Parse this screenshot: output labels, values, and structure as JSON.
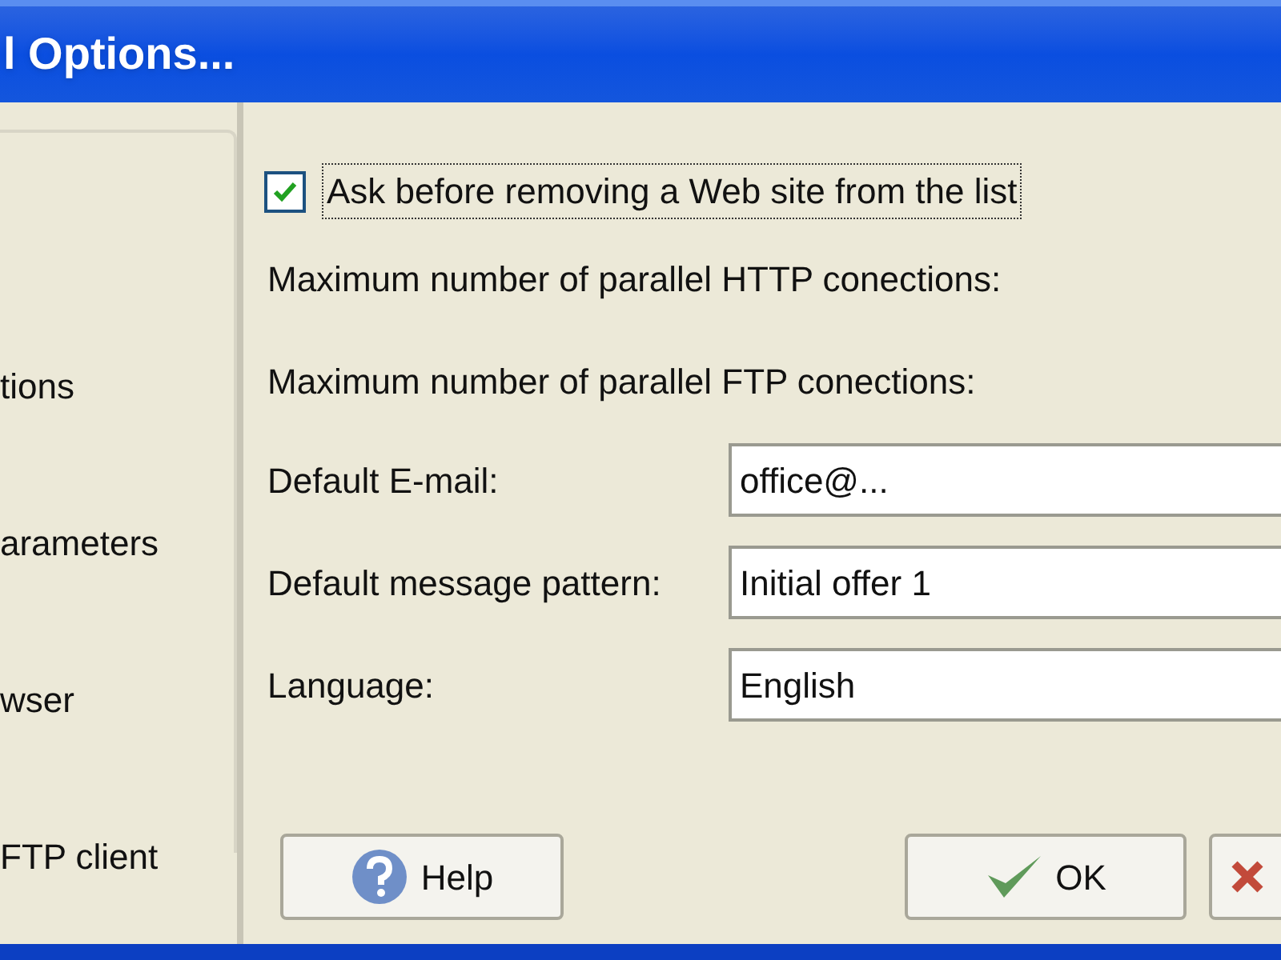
{
  "window": {
    "title": "l Options..."
  },
  "sidebar": {
    "items": [
      {
        "label": "tions"
      },
      {
        "label": "arameters"
      },
      {
        "label": "wser"
      },
      {
        "label": "FTP client"
      }
    ]
  },
  "options": {
    "ask_before_removing": {
      "label": "Ask before removing a Web site from the list",
      "checked": true
    },
    "labels": [
      "Maximum number of parallel HTTP conections:",
      "Maximum number of parallel FTP conections:"
    ],
    "fields": [
      {
        "label": "Default E-mail:",
        "value": "office@..."
      },
      {
        "label": "Default message pattern:",
        "value": "Initial offer 1"
      },
      {
        "label": "Language:",
        "value": "English"
      }
    ]
  },
  "buttons": [
    {
      "kind": "help",
      "label": "Help"
    },
    {
      "kind": "ok",
      "label": "OK"
    },
    {
      "kind": "cancel"
    }
  ]
}
